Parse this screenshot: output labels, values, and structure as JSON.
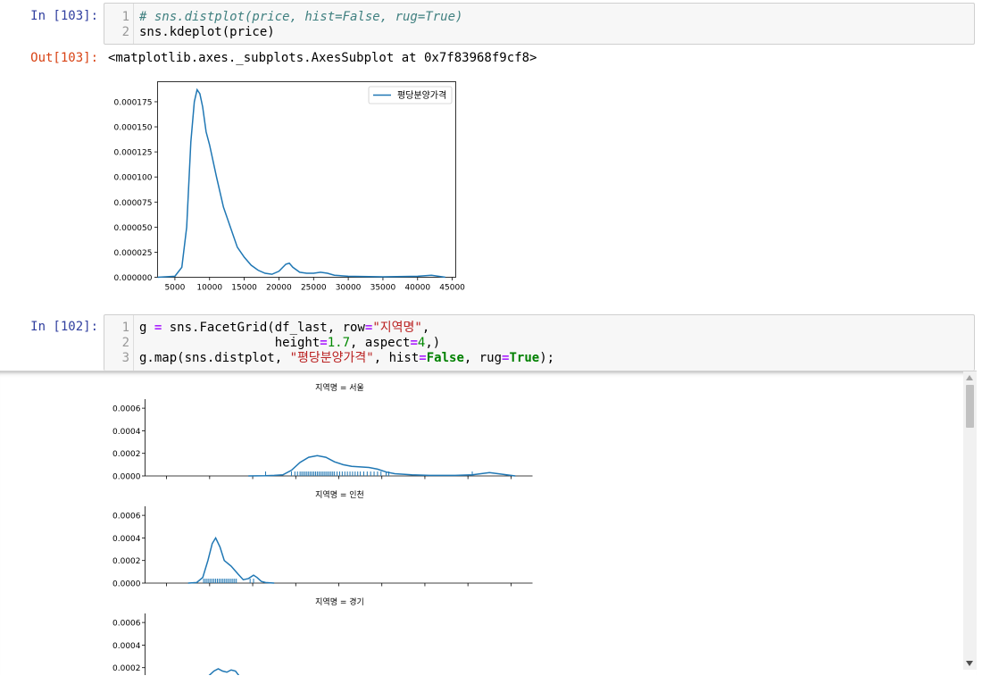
{
  "cells": [
    {
      "prompt": "In [103]:",
      "lines": [
        {
          "no": "1",
          "parts": [
            {
              "t": "# sns.distplot(price, hist=False, rug=True)",
              "c": "comment"
            }
          ]
        },
        {
          "no": "2",
          "parts": [
            {
              "t": "sns.kdeplot(price)",
              "c": ""
            }
          ]
        }
      ]
    },
    {
      "prompt": "In [102]:",
      "lines": [
        {
          "no": "1",
          "parts": [
            {
              "t": "g ",
              "c": ""
            },
            {
              "t": "=",
              "c": "op"
            },
            {
              "t": " sns.FacetGrid(df_last, row",
              "c": ""
            },
            {
              "t": "=",
              "c": "op"
            },
            {
              "t": "\"지역명\"",
              "c": "str"
            },
            {
              "t": ",",
              "c": ""
            }
          ]
        },
        {
          "no": "2",
          "parts": [
            {
              "t": "                  height",
              "c": ""
            },
            {
              "t": "=",
              "c": "op"
            },
            {
              "t": "1.7",
              "c": "num"
            },
            {
              "t": ", aspect",
              "c": ""
            },
            {
              "t": "=",
              "c": "op"
            },
            {
              "t": "4",
              "c": "num"
            },
            {
              "t": ",)",
              "c": ""
            }
          ]
        },
        {
          "no": "3",
          "parts": [
            {
              "t": "g.map(sns.distplot, ",
              "c": ""
            },
            {
              "t": "\"평당분양가격\"",
              "c": "str"
            },
            {
              "t": ", hist",
              "c": ""
            },
            {
              "t": "=",
              "c": "op"
            },
            {
              "t": "False",
              "c": "kw"
            },
            {
              "t": ", rug",
              "c": ""
            },
            {
              "t": "=",
              "c": "op"
            },
            {
              "t": "True",
              "c": "kw"
            },
            {
              "t": ");",
              "c": ""
            }
          ]
        }
      ]
    }
  ],
  "output": {
    "prompt": "Out[103]:",
    "text": "<matplotlib.axes._subplots.AxesSubplot at 0x7f83968f9cf8>"
  },
  "chart_data": [
    {
      "type": "line",
      "title": "",
      "xlabel": "",
      "ylabel": "",
      "legend": {
        "entries": [
          "평당분양가격"
        ],
        "placement": "top-right"
      },
      "xlim": [
        2500,
        45500
      ],
      "ylim": [
        0,
        0.000195
      ],
      "xticks": [
        5000,
        10000,
        15000,
        20000,
        25000,
        30000,
        35000,
        40000,
        45000
      ],
      "xtick_labels": [
        "5000",
        "10000",
        "15000",
        "20000",
        "25000",
        "30000",
        "35000",
        "40000",
        "45000"
      ],
      "yticks": [
        0,
        2.5e-05,
        5e-05,
        7.5e-05,
        0.0001,
        0.000125,
        0.00015,
        0.000175
      ],
      "ytick_labels": [
        "0.000000",
        "0.000025",
        "0.000050",
        "0.000075",
        "0.000100",
        "0.000125",
        "0.000150",
        "0.000175"
      ],
      "color": "#1f77b4",
      "series": [
        {
          "name": "평당분양가격",
          "x": [
            2500,
            5000,
            6000,
            6700,
            7300,
            7800,
            8200,
            8600,
            9000,
            9500,
            10000,
            11000,
            12000,
            13000,
            14000,
            15000,
            16000,
            17000,
            18000,
            19000,
            20000,
            21000,
            21500,
            22000,
            23000,
            24000,
            25000,
            26000,
            27000,
            28000,
            30000,
            35000,
            40000,
            42000,
            43000,
            44000
          ],
          "y": [
            0,
            1e-06,
            1e-05,
            5e-05,
            0.000135,
            0.000175,
            0.000187,
            0.000183,
            0.00017,
            0.000145,
            0.000132,
            0.0001,
            7e-05,
            5e-05,
            3e-05,
            2e-05,
            1.2e-05,
            7e-06,
            4e-06,
            3e-06,
            6e-06,
            1.3e-05,
            1.4e-05,
            1e-05,
            5e-06,
            4e-06,
            4e-06,
            5e-06,
            4e-06,
            2e-06,
            1e-06,
            5e-07,
            1e-06,
            2e-06,
            1e-06,
            0
          ]
        }
      ]
    },
    {
      "type": "line",
      "title": "지역명 = 서울",
      "xlabel": "",
      "ylabel": "",
      "ylim": [
        0,
        0.00068
      ],
      "yticks": [
        0,
        0.0002,
        0.0004,
        0.0006
      ],
      "ytick_labels": [
        "0.0000",
        "0.0002",
        "0.0004",
        "0.0006"
      ],
      "xlim": [
        0,
        45000
      ],
      "xticks": [
        2500,
        7500,
        12500,
        17500,
        22500,
        27500,
        32500,
        37500,
        42500
      ],
      "color": "#1f77b4",
      "series": [
        {
          "x": [
            12000,
            14000,
            15000,
            16000,
            17000,
            18000,
            19000,
            20000,
            21000,
            22000,
            23000,
            24000,
            25000,
            26000,
            27000,
            28000,
            29000,
            31000,
            33000,
            36000,
            38000,
            40000,
            42000,
            43000
          ],
          "y": [
            0,
            2e-06,
            5e-06,
            1e-05,
            5e-05,
            0.00012,
            0.000165,
            0.00018,
            0.000165,
            0.000125,
            0.0001,
            8.5e-05,
            8e-05,
            7.5e-05,
            6e-05,
            3.5e-05,
            2e-05,
            1e-05,
            5e-06,
            5e-06,
            1e-05,
            3e-05,
            1e-05,
            0
          ]
        }
      ],
      "rug": [
        14000,
        17000,
        17400,
        17700,
        18000,
        18200,
        18400,
        18600,
        18800,
        19000,
        19200,
        19400,
        19600,
        19800,
        20000,
        20200,
        20400,
        20600,
        20800,
        21000,
        21200,
        21400,
        21600,
        21800,
        22000,
        22300,
        22600,
        22900,
        23200,
        23500,
        23800,
        24100,
        24400,
        24700,
        25000,
        25400,
        25800,
        26200,
        26600,
        27000,
        27400,
        28000,
        28300,
        38000
      ]
    },
    {
      "type": "line",
      "title": "지역명 = 인천",
      "xlabel": "",
      "ylabel": "",
      "ylim": [
        0,
        0.00068
      ],
      "yticks": [
        0,
        0.0002,
        0.0004,
        0.0006
      ],
      "ytick_labels": [
        "0.0000",
        "0.0002",
        "0.0004",
        "0.0006"
      ],
      "xlim": [
        0,
        45000
      ],
      "xticks": [
        2500,
        7500,
        12500,
        17500,
        22500,
        27500,
        32500,
        37500,
        42500
      ],
      "color": "#1f77b4",
      "series": [
        {
          "x": [
            5000,
            6000,
            6700,
            7300,
            7800,
            8200,
            8700,
            9200,
            10000,
            10800,
            11400,
            12000,
            12600,
            13000,
            13500,
            14000,
            15000
          ],
          "y": [
            0,
            5e-06,
            5e-05,
            0.0002,
            0.00035,
            0.0004,
            0.00032,
            0.0002,
            0.00015,
            8e-05,
            3e-05,
            4e-05,
            7e-05,
            5e-05,
            1.5e-05,
            5e-06,
            0
          ]
        }
      ],
      "rug": [
        6800,
        7000,
        7200,
        7400,
        7600,
        7800,
        8000,
        8200,
        8400,
        8600,
        8800,
        9000,
        9200,
        9400,
        9600,
        9800,
        10000,
        10200,
        10400,
        10600,
        12200,
        12600
      ]
    },
    {
      "type": "line",
      "title": "지역명 = 경기",
      "xlabel": "",
      "ylabel": "",
      "ylim": [
        0,
        0.00068
      ],
      "yticks": [
        0,
        0.0002,
        0.0004,
        0.0006
      ],
      "ytick_labels": [
        "0.0000",
        "0.0002",
        "0.0004",
        "0.0006"
      ],
      "xlim": [
        0,
        45000
      ],
      "color": "#1f77b4",
      "series": [
        {
          "x": [
            7000,
            8000,
            8500,
            9000,
            9500,
            10000,
            10500,
            11000
          ],
          "y": [
            0.0001,
            0.00017,
            0.00019,
            0.00017,
            0.00016,
            0.00018,
            0.00017,
            0.00012
          ]
        }
      ]
    }
  ]
}
